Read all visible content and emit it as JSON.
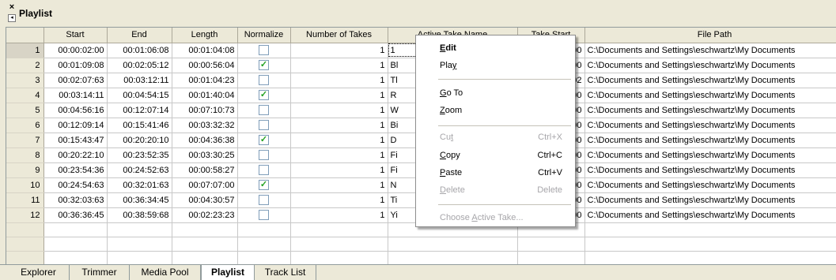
{
  "panel": {
    "title": "Playlist",
    "close_glyph": "×",
    "pin_glyph": "◂"
  },
  "columns": [
    "",
    "Start",
    "End",
    "Length",
    "Normalize",
    "Number of Takes",
    "Active Take Name",
    "Take Start",
    "File Path"
  ],
  "rows": [
    {
      "n": "1",
      "start": "00:00:02:00",
      "end": "00:01:06:08",
      "length": "00:01:04:08",
      "normalize": false,
      "takes": "1",
      "take_name": "1",
      "take_start": "0:00",
      "path": "C:\\Documents and Settings\\eschwartz\\My Documents"
    },
    {
      "n": "2",
      "start": "00:01:09:08",
      "end": "00:02:05:12",
      "length": "00:00:56:04",
      "normalize": true,
      "takes": "1",
      "take_name": "Bl",
      "take_start": "0:00",
      "path": "C:\\Documents and Settings\\eschwartz\\My Documents"
    },
    {
      "n": "3",
      "start": "00:02:07:63",
      "end": "00:03:12:11",
      "length": "00:01:04:23",
      "normalize": false,
      "takes": "1",
      "take_name": "Tl",
      "take_start": "7:02",
      "path": "C:\\Documents and Settings\\eschwartz\\My Documents"
    },
    {
      "n": "4",
      "start": "00:03:14:11",
      "end": "00:04:54:15",
      "length": "00:01:40:04",
      "normalize": true,
      "takes": "1",
      "take_name": "R",
      "take_start": "0:00",
      "path": "C:\\Documents and Settings\\eschwartz\\My Documents"
    },
    {
      "n": "5",
      "start": "00:04:56:16",
      "end": "00:12:07:14",
      "length": "00:07:10:73",
      "normalize": false,
      "takes": "1",
      "take_name": "W",
      "take_start": "0:00",
      "path": "C:\\Documents and Settings\\eschwartz\\My Documents"
    },
    {
      "n": "6",
      "start": "00:12:09:14",
      "end": "00:15:41:46",
      "length": "00:03:32:32",
      "normalize": false,
      "takes": "1",
      "take_name": "Bi",
      "take_start": "0:00",
      "path": "C:\\Documents and Settings\\eschwartz\\My Documents"
    },
    {
      "n": "7",
      "start": "00:15:43:47",
      "end": "00:20:20:10",
      "length": "00:04:36:38",
      "normalize": true,
      "takes": "1",
      "take_name": "D",
      "take_start": "0:00",
      "path": "C:\\Documents and Settings\\eschwartz\\My Documents"
    },
    {
      "n": "8",
      "start": "00:20:22:10",
      "end": "00:23:52:35",
      "length": "00:03:30:25",
      "normalize": false,
      "takes": "1",
      "take_name": "Fi",
      "take_start": "0:00",
      "path": "C:\\Documents and Settings\\eschwartz\\My Documents"
    },
    {
      "n": "9",
      "start": "00:23:54:36",
      "end": "00:24:52:63",
      "length": "00:00:58:27",
      "normalize": false,
      "takes": "1",
      "take_name": "Fi",
      "take_start": "0:00",
      "path": "C:\\Documents and Settings\\eschwartz\\My Documents"
    },
    {
      "n": "10",
      "start": "00:24:54:63",
      "end": "00:32:01:63",
      "length": "00:07:07:00",
      "normalize": true,
      "takes": "1",
      "take_name": "N",
      "take_start": "0:00",
      "path": "C:\\Documents and Settings\\eschwartz\\My Documents"
    },
    {
      "n": "11",
      "start": "00:32:03:63",
      "end": "00:36:34:45",
      "length": "00:04:30:57",
      "normalize": false,
      "takes": "1",
      "take_name": "Ti",
      "take_start": "0:00",
      "path": "C:\\Documents and Settings\\eschwartz\\My Documents"
    },
    {
      "n": "12",
      "start": "00:36:36:45",
      "end": "00:38:59:68",
      "length": "00:02:23:23",
      "normalize": false,
      "takes": "1",
      "take_name": "Yi",
      "take_start": "0:00",
      "path": "C:\\Documents and Settings\\eschwartz\\My Documents"
    }
  ],
  "context_menu": {
    "edit": {
      "label": "Edit",
      "key": "E",
      "rest": "dit"
    },
    "play": {
      "pre": "Pla",
      "key": "y"
    },
    "goto": {
      "key": "G",
      "rest": "o To"
    },
    "zoom": {
      "key": "Z",
      "rest": "oom"
    },
    "cut": {
      "pre": "Cu",
      "key": "t",
      "shortcut": "Ctrl+X"
    },
    "copy": {
      "key": "C",
      "rest": "opy",
      "shortcut": "Ctrl+C"
    },
    "paste": {
      "key": "P",
      "rest": "aste",
      "shortcut": "Ctrl+V"
    },
    "delete": {
      "key": "D",
      "rest": "elete",
      "shortcut": "Delete"
    },
    "choose": {
      "pre": "Choose ",
      "key": "A",
      "rest": "ctive Take..."
    }
  },
  "tabs": [
    "Explorer",
    "Trimmer",
    "Media Pool",
    "Playlist",
    "Track List"
  ],
  "selected_tab": "Playlist",
  "colors": {
    "chrome": "#ece9d8",
    "grid_line": "#c8c8c8",
    "check": "#21a121"
  }
}
